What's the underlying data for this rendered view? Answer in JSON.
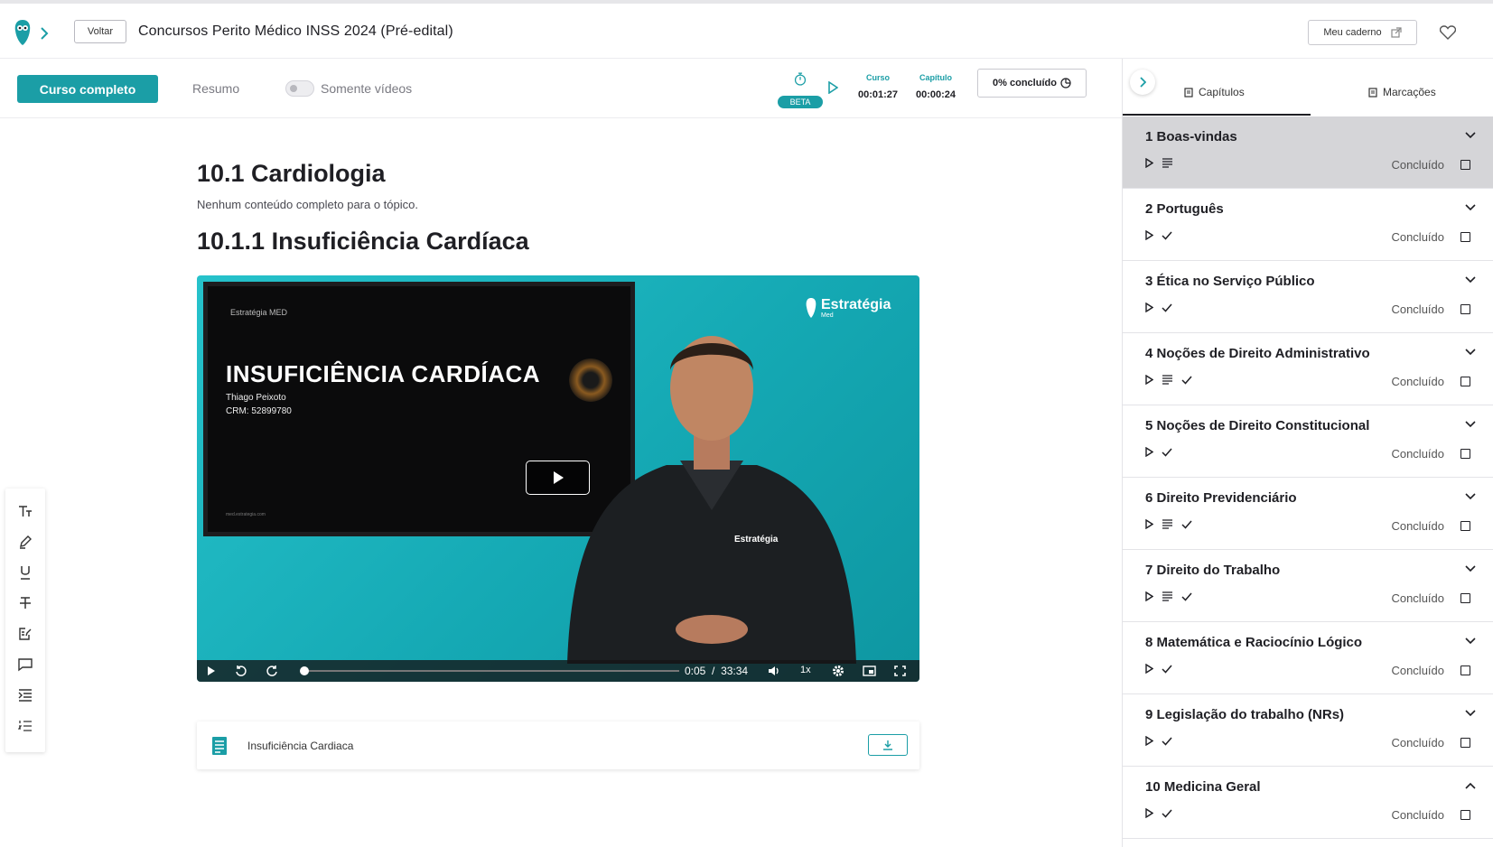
{
  "header": {
    "back_label": "Voltar",
    "course_title": "Concursos Perito Médico INSS 2024 (Pré-edital)",
    "notebook_label": "Meu caderno"
  },
  "subbar": {
    "full_course_label": "Curso completo",
    "summary_label": "Resumo",
    "videos_only_label": "Somente vídeos",
    "videos_only_enabled": false,
    "beta_label": "BETA",
    "course_timer_label": "Curso",
    "course_timer_value": "00:01:27",
    "chapter_timer_label": "Capítulo",
    "chapter_timer_value": "00:00:24",
    "progress_label": "0% concluído"
  },
  "sidebar": {
    "tab_chapters": "Capítulos",
    "tab_bookmarks": "Marcações",
    "chapters": [
      {
        "title": "1 Boas-vindas",
        "icons": [
          "play",
          "text"
        ],
        "status": "Concluído",
        "active": true,
        "expanded": false
      },
      {
        "title": "2 Português",
        "icons": [
          "play",
          "check"
        ],
        "status": "Concluído",
        "active": false,
        "expanded": false
      },
      {
        "title": "3 Ética no Serviço Público",
        "icons": [
          "play",
          "check"
        ],
        "status": "Concluído",
        "active": false,
        "expanded": false
      },
      {
        "title": "4 Noções de Direito Administrativo",
        "icons": [
          "play",
          "text",
          "check"
        ],
        "status": "Concluído",
        "active": false,
        "expanded": false
      },
      {
        "title": "5 Noções de Direito Constitucional",
        "icons": [
          "play",
          "check"
        ],
        "status": "Concluído",
        "active": false,
        "expanded": false
      },
      {
        "title": "6 Direito Previdenciário",
        "icons": [
          "play",
          "text",
          "check"
        ],
        "status": "Concluído",
        "active": false,
        "expanded": false
      },
      {
        "title": "7 Direito do Trabalho",
        "icons": [
          "play",
          "text",
          "check"
        ],
        "status": "Concluído",
        "active": false,
        "expanded": false
      },
      {
        "title": "8 Matemática e Raciocínio Lógico",
        "icons": [
          "play",
          "check"
        ],
        "status": "Concluído",
        "active": false,
        "expanded": false
      },
      {
        "title": "9 Legislação do trabalho (NRs)",
        "icons": [
          "play",
          "check"
        ],
        "status": "Concluído",
        "active": false,
        "expanded": false
      },
      {
        "title": "10 Medicina Geral",
        "icons": [
          "play",
          "check"
        ],
        "status": "Concluído",
        "active": false,
        "expanded": true
      }
    ]
  },
  "tools": [
    "text-size-icon",
    "highlighter-icon",
    "underline-icon",
    "strikethrough-icon",
    "note-edit-icon",
    "comment-icon",
    "indent-icon",
    "numbered-list-icon"
  ],
  "main": {
    "topic_title": "10.1 Cardiologia",
    "topic_subtitle": "Nenhum conteúdo completo para o tópico.",
    "lesson_title": "10.1.1 Insuficiência Cardíaca",
    "video": {
      "slide_brand": "Estratégia MED",
      "slide_title": "INSUFICIÊNCIA CARDÍACA",
      "slide_author": "Thiago Peixoto",
      "slide_crm": "CRM: 52899780",
      "slide_url": "med.estrategia.com",
      "brand": "Estratégia",
      "brand_sub": "Med",
      "shirt_brand": "Estratégia",
      "current_time": "0:05",
      "duration": "33:34",
      "speed": "1x",
      "progress": 0.0025
    },
    "material": {
      "name": "Insuficiência Cardiaca"
    }
  },
  "colors": {
    "accent": "#1b9ea6",
    "active_chapter_bg": "#d5d5d8"
  }
}
